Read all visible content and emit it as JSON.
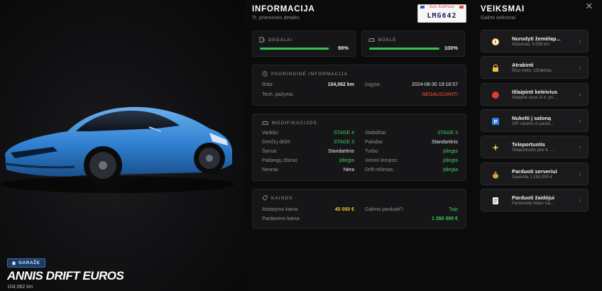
{
  "garage": {
    "badge": "GARAŽE",
    "car_name": "ANNIS DRIFT EUROS",
    "mileage": "104,062 km"
  },
  "info": {
    "title": "INFORMACIJA",
    "subtitle": "Tr. priemonės detalės",
    "plate": {
      "state": "San Andreas",
      "number": "LMG642"
    },
    "fuel": {
      "label": "DEGALAI",
      "value": "98%",
      "level": 0.98
    },
    "condition": {
      "label": "BŪKLĖ",
      "value": "100%",
      "level": 1.0
    },
    "basic": {
      "heading": "PAGRINDINĖ INFORMACIJA",
      "mileage_label": "Rida:",
      "mileage_value": "104,062 km",
      "acquired_label": "Įsigyta:",
      "acquired_value": "2024-08-30 19:18:57",
      "tech_label": "Tech. pažyma:",
      "tech_value": "NEGALIOJANTI"
    },
    "mods": {
      "heading": "MODIFIKACIJOS",
      "left": [
        {
          "k": "Variklis:",
          "v": "STAGE 4",
          "c": "green"
        },
        {
          "k": "Greičių dėžė:",
          "v": "STAGE 3",
          "c": "green"
        },
        {
          "k": "Šarvai:",
          "v": "Standartinis",
          "c": ""
        },
        {
          "k": "Padangų dūmai:",
          "v": "Įdiegta",
          "c": "green"
        },
        {
          "k": "Neonai:",
          "v": "Nėra",
          "c": ""
        }
      ],
      "right": [
        {
          "k": "Stabdžiai:",
          "v": "STAGE 3",
          "c": "green"
        },
        {
          "k": "Pakaba:",
          "v": "Standartinis",
          "c": ""
        },
        {
          "k": "Turbo:",
          "v": "Įdiegta",
          "c": "green"
        },
        {
          "k": "Xenon lempos:",
          "v": "Įdiegta",
          "c": "green"
        },
        {
          "k": "Drift režimas:",
          "v": "Įdiegta",
          "c": "green"
        }
      ]
    },
    "prices": {
      "heading": "KAINOS",
      "restore_label": "Atstatymo kaina:",
      "restore_value": "45 000 €",
      "sellable_label": "Galima parduoti?:",
      "sellable_value": "Taip",
      "sale_label": "Pardavimo kaina:",
      "sale_value": "1 260 000 €"
    }
  },
  "actions": {
    "title": "VEIKSMAI",
    "subtitle": "Galimi veiksmai",
    "items": [
      {
        "title": "Nurodyti žemėlap...",
        "sub": "Atstumas: 0.008 km",
        "icon": "compass-icon"
      },
      {
        "title": "Atrakinti",
        "sub": "Šiuo metu: Užrakinta",
        "icon": "lock-icon"
      },
      {
        "title": "Išlaipinti keleivius",
        "sub": "Išlaipinti visus iš tr. pri...",
        "icon": "eject-icon"
      },
      {
        "title": "Nukelti į saloną",
        "sub": "VIP narams iš pasta...",
        "icon": "parking-icon"
      },
      {
        "title": "Teleportuotis",
        "sub": "Teleportuotis prie tr. ...",
        "icon": "sparkle-icon"
      },
      {
        "title": "Parduoti serveriui",
        "sub": "Gauksite 1,250,000 €",
        "icon": "money-bag-icon"
      },
      {
        "title": "Parduoti žaidėjui",
        "sub": "Parduokite kitam žai...",
        "icon": "document-icon"
      }
    ]
  },
  "colors": {
    "accent_green": "#31c653",
    "danger": "#ff4c3d",
    "price_yellow": "#f3c42a",
    "badge_blue": "#1c3d63"
  }
}
